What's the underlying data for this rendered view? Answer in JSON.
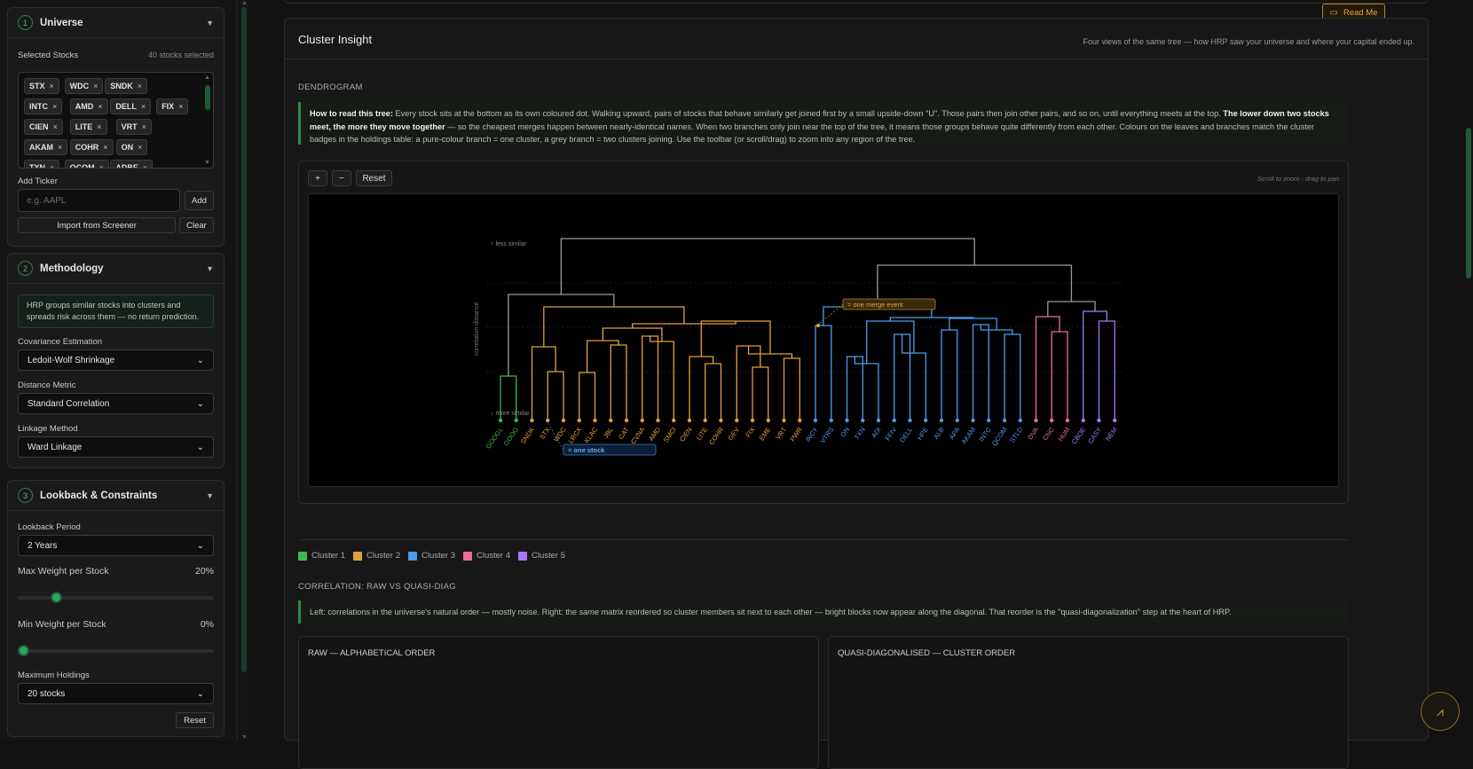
{
  "sidebar": {
    "universe": {
      "number": "1",
      "title": "Universe",
      "selected_label": "Selected Stocks",
      "selected_count": "40 stocks selected",
      "chips": [
        "STX",
        "WDC",
        "SNDK",
        "INTC",
        "AMD",
        "DELL",
        "FIX",
        "CIEN",
        "LITE",
        "VRT",
        "AKAM",
        "COHR",
        "ON",
        "TXN",
        "QCOM",
        "ADBE"
      ],
      "chip_remove": "×",
      "add_ticker_label": "Add Ticker",
      "ticker_placeholder": "e.g. AAPL",
      "add_button": "Add",
      "import_button": "Import from Screener",
      "clear_button": "Clear"
    },
    "methodology": {
      "number": "2",
      "title": "Methodology",
      "info": "HRP groups similar stocks into clusters and spreads risk across them — no return prediction.",
      "cov_label": "Covariance Estimation",
      "cov_value": "Ledoit-Wolf Shrinkage",
      "dist_label": "Distance Metric",
      "dist_value": "Standard Correlation",
      "link_label": "Linkage Method",
      "link_value": "Ward Linkage"
    },
    "lookback": {
      "number": "3",
      "title": "Lookback & Constraints",
      "period_label": "Lookback Period",
      "period_value": "2 Years",
      "maxw_label": "Max Weight per Stock",
      "maxw_value": "20%",
      "maxw_fraction": 0.18,
      "minw_label": "Min Weight per Stock",
      "minw_value": "0%",
      "minw_fraction": 0.0,
      "holdings_label": "Maximum Holdings",
      "holdings_value": "20 stocks",
      "reset_button": "Reset"
    }
  },
  "main": {
    "readme_button": "Read Me",
    "title": "Cluster Insight",
    "subtitle": "Four views of the same tree — how HRP saw your universe and where your capital ended up.",
    "dendrogram": {
      "section_label": "DENDROGRAM",
      "help_lead": "How to read this tree:",
      "help_body": " Every stock sits at the bottom as its own coloured dot. Walking upward, pairs of stocks that behave similarly get joined first by a small upside-down \"U\". Those pairs then join other pairs, and so on, until everything meets at the top. ",
      "help_bold": "The lower down two stocks meet, the more they move together",
      "help_tail": " — so the cheapest merges happen between nearly-identical names. When two branches only join near the top of the tree, it means those groups behave quite differently from each other. Colours on the leaves and branches match the cluster badges in the holdings table: a pure-colour branch = one cluster, a grey branch = two clusters joining. Use the toolbar (or scroll/drag) to zoom into any region of the tree.",
      "zoom_in": "+",
      "zoom_out": "−",
      "reset": "Reset",
      "zoom_hint": "Scroll to zoom · drag to pan",
      "less_similar": "↑ less similar",
      "more_similar": "↓ more similar",
      "axis_label": "correlation distance",
      "merge_callout": "= one merge event",
      "leaf_callout": "= one stock"
    },
    "clusters": [
      {
        "name": "Cluster 1",
        "color": "#3fb950"
      },
      {
        "name": "Cluster 2",
        "color": "#e3a03a"
      },
      {
        "name": "Cluster 3",
        "color": "#4d9cf0"
      },
      {
        "name": "Cluster 4",
        "color": "#f06a9c"
      },
      {
        "name": "Cluster 5",
        "color": "#a679f0"
      }
    ],
    "leaves": [
      {
        "t": "GOOGL",
        "c": 0
      },
      {
        "t": "GOOG",
        "c": 0
      },
      {
        "t": "SNDK",
        "c": 1
      },
      {
        "t": "STX",
        "c": 1
      },
      {
        "t": "WDC",
        "c": 1
      },
      {
        "t": "LRCX",
        "c": 1
      },
      {
        "t": "KLAC",
        "c": 1
      },
      {
        "t": "JBL",
        "c": 1
      },
      {
        "t": "CAT",
        "c": 1
      },
      {
        "t": "CVNA",
        "c": 1
      },
      {
        "t": "AMD",
        "c": 1
      },
      {
        "t": "SMCI",
        "c": 1
      },
      {
        "t": "CIEN",
        "c": 1
      },
      {
        "t": "LITE",
        "c": 1
      },
      {
        "t": "COHR",
        "c": 1
      },
      {
        "t": "GEV",
        "c": 1
      },
      {
        "t": "FIX",
        "c": 1
      },
      {
        "t": "EME",
        "c": 1
      },
      {
        "t": "VRT",
        "c": 1
      },
      {
        "t": "PWR",
        "c": 1
      },
      {
        "t": "INCY",
        "c": 2
      },
      {
        "t": "VTRS",
        "c": 2
      },
      {
        "t": "ON",
        "c": 2
      },
      {
        "t": "TXN",
        "c": 2
      },
      {
        "t": "ADI",
        "c": 2
      },
      {
        "t": "FFIV",
        "c": 2
      },
      {
        "t": "DELL",
        "c": 2
      },
      {
        "t": "HPE",
        "c": 2
      },
      {
        "t": "ALB",
        "c": 2
      },
      {
        "t": "APA",
        "c": 2
      },
      {
        "t": "AKAM",
        "c": 2
      },
      {
        "t": "INTC",
        "c": 2
      },
      {
        "t": "QCOM",
        "c": 2
      },
      {
        "t": "STLD",
        "c": 2
      },
      {
        "t": "DVA",
        "c": 3
      },
      {
        "t": "CNC",
        "c": 3
      },
      {
        "t": "HUM",
        "c": 3
      },
      {
        "t": "CBOE",
        "c": 4
      },
      {
        "t": "CASY",
        "c": 4
      },
      {
        "t": "NEM",
        "c": 4
      }
    ],
    "correlation": {
      "section_label": "CORRELATION: RAW VS QUASI-DIAG",
      "help_a": "Left: correlations in the universe's natural order — mostly noise. Right: the ",
      "help_em": "same",
      "help_b": " matrix reordered so cluster members sit next to each other — bright blocks now appear along the diagonal. That reorder is the \"quasi-diagonalization\" step at the heart of HRP.",
      "raw_title": "RAW — ALPHABETICAL ORDER",
      "quasi_title": "QUASI-DIAGONALISED — CLUSTER ORDER"
    }
  }
}
